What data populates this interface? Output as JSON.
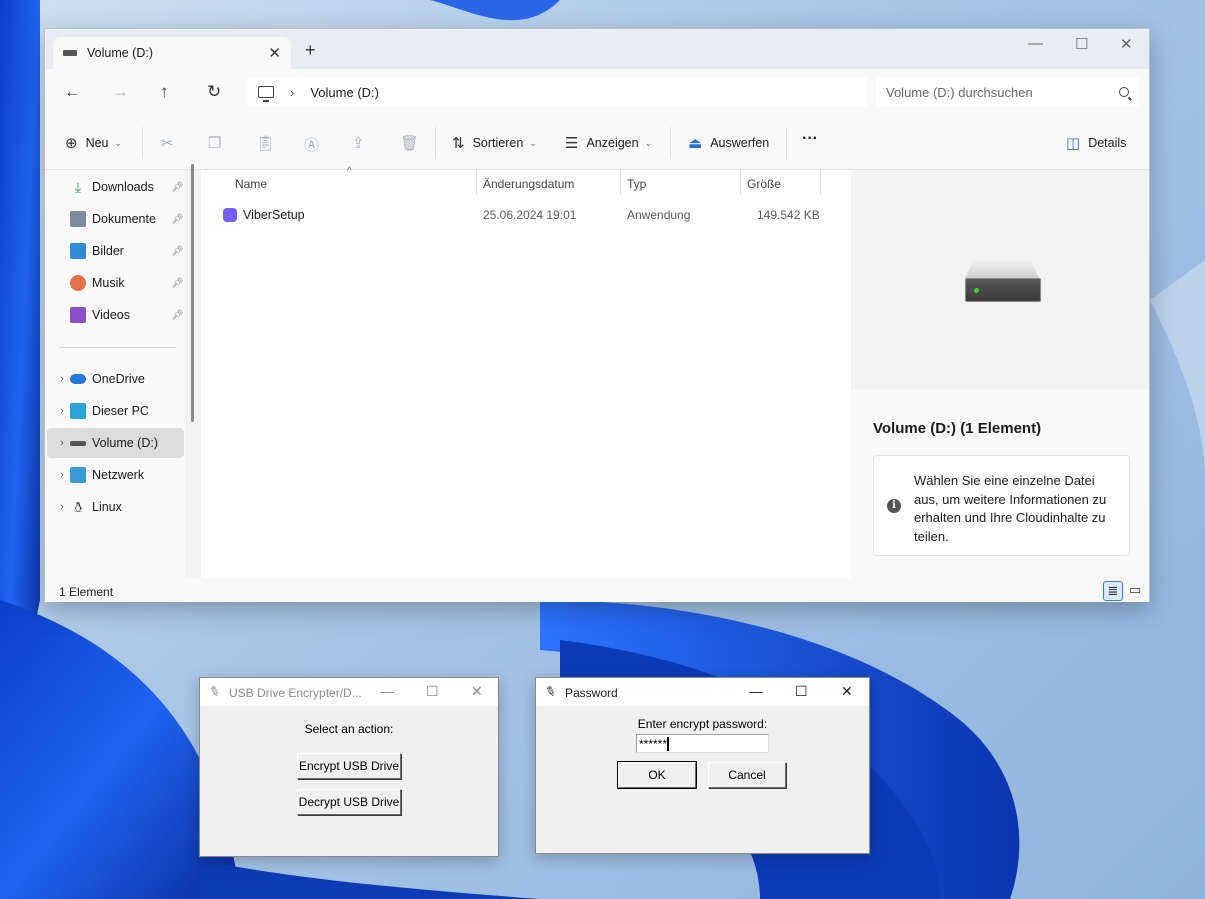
{
  "explorer": {
    "tab_title": "Volume (D:)",
    "address_crumb": "Volume (D:)",
    "search_placeholder": "Volume (D:) durchsuchen",
    "toolbar": {
      "new_label": "Neu",
      "sort_label": "Sortieren",
      "view_label": "Anzeigen",
      "eject_label": "Auswerfen",
      "more_label": "···",
      "details_label": "Details"
    },
    "sidebar": {
      "quick_access": [
        {
          "label": "Downloads",
          "icon": "download-icon"
        },
        {
          "label": "Dokumente",
          "icon": "documents-icon"
        },
        {
          "label": "Bilder",
          "icon": "pictures-icon"
        },
        {
          "label": "Musik",
          "icon": "music-icon"
        },
        {
          "label": "Videos",
          "icon": "videos-icon"
        }
      ],
      "locations": [
        {
          "label": "OneDrive",
          "icon": "onedrive-icon"
        },
        {
          "label": "Dieser PC",
          "icon": "pc-icon"
        },
        {
          "label": "Volume (D:)",
          "icon": "drive-icon",
          "selected": true
        },
        {
          "label": "Netzwerk",
          "icon": "network-icon"
        },
        {
          "label": "Linux",
          "icon": "linux-icon"
        }
      ]
    },
    "columns": [
      "Name",
      "Änderungsdatum",
      "Typ",
      "Größe"
    ],
    "files": [
      {
        "name": "ViberSetup",
        "modified": "25.06.2024 19:01",
        "type": "Anwendung",
        "size": "149.542 KB"
      }
    ],
    "details_title": "Volume (D:) (1 Element)",
    "details_info": "Wählen Sie eine einzelne Datei aus, um weitere Informationen zu erhalten und Ihre Cloudinhalte zu teilen.",
    "status": "1 Element"
  },
  "encrypter": {
    "title": "USB Drive Encrypter/D...",
    "prompt": "Select an action:",
    "encrypt_label": "Encrypt USB Drive",
    "decrypt_label": "Decrypt USB Drive"
  },
  "password": {
    "title": "Password",
    "prompt": "Enter encrypt password:",
    "value": "******",
    "ok_label": "OK",
    "cancel_label": "Cancel"
  },
  "colors": {
    "accent": "#3c7dd8",
    "wallpaper_blue": "#1a4fd6"
  }
}
